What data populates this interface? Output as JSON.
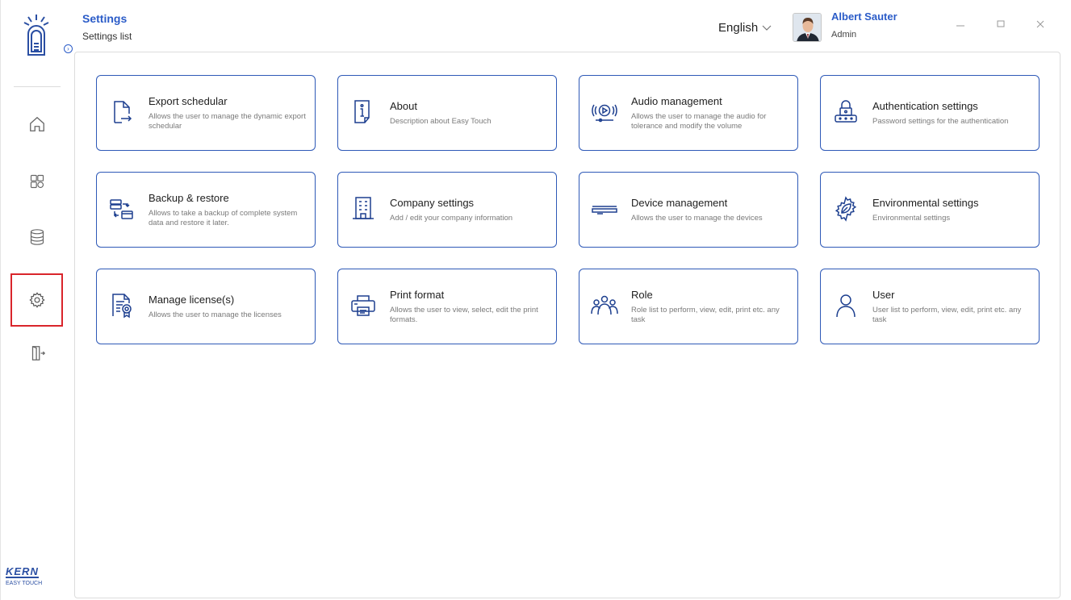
{
  "header": {
    "title": "Settings",
    "subtitle": "Settings list",
    "language": "English",
    "user_name": "Albert Sauter",
    "user_role": "Admin",
    "window_controls": [
      "minimize-icon",
      "maximize-icon",
      "close-icon"
    ]
  },
  "sidebar": {
    "items": [
      {
        "icon": "home-icon"
      },
      {
        "icon": "dashboard-icon"
      },
      {
        "icon": "database-icon"
      },
      {
        "icon": "settings-gear-icon",
        "active": true
      },
      {
        "icon": "logout-icon"
      }
    ],
    "brand": "KERN",
    "brand_sub": "EASY TOUCH"
  },
  "cards": [
    {
      "title": "Export schedular",
      "desc": "Allows the user to manage the dynamic export schedular",
      "icon": "export-file-icon"
    },
    {
      "title": "About",
      "desc": "Description about Easy Touch",
      "icon": "info-document-icon"
    },
    {
      "title": "Audio management",
      "desc": "Allows the user to manage the audio for tolerance and modify the volume",
      "icon": "audio-play-icon"
    },
    {
      "title": "Authentication settings",
      "desc": "Password settings for the authentication",
      "icon": "lock-password-icon"
    },
    {
      "title": "Backup & restore",
      "desc": "Allows to take a backup of complete system data and restore it later.",
      "icon": "backup-restore-icon"
    },
    {
      "title": "Company settings",
      "desc": "Add / edit your company information",
      "icon": "building-icon"
    },
    {
      "title": "Device management",
      "desc": "Allows the user to manage the devices",
      "icon": "device-icon"
    },
    {
      "title": "Environmental settings",
      "desc": "Environmental settings",
      "icon": "leaf-gear-icon"
    },
    {
      "title": "Manage license(s)",
      "desc": "Allows the user to manage the licenses",
      "icon": "license-certificate-icon"
    },
    {
      "title": "Print format",
      "desc": "Allows the user to view, select, edit the print formats.",
      "icon": "printer-icon"
    },
    {
      "title": "Role",
      "desc": "Role list to perform, view, edit, print etc. any task",
      "icon": "group-users-icon"
    },
    {
      "title": "User",
      "desc": "User list to perform, view, edit, print etc. any task",
      "icon": "user-icon"
    }
  ],
  "colors": {
    "accent": "#2b5cc8",
    "card_border": "#2e59b7",
    "active_outline": "#d9252b"
  }
}
